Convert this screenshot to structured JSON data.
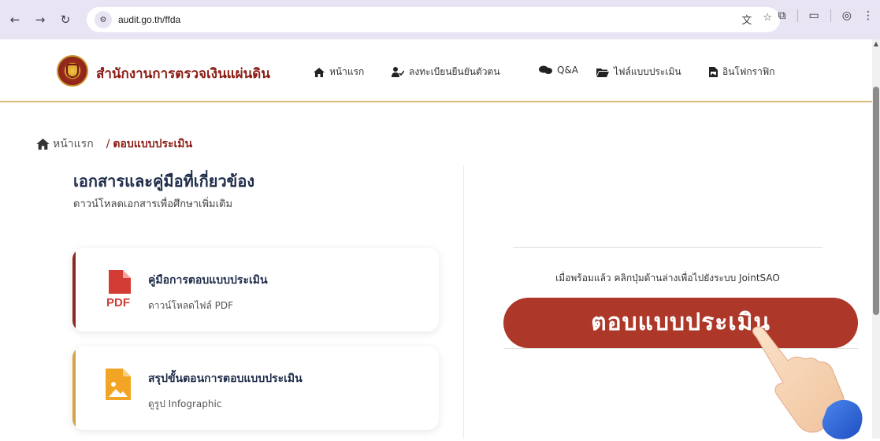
{
  "browser": {
    "back_icon": "arrow-left-icon",
    "forward_icon": "arrow-right-icon",
    "reload_icon": "reload-icon",
    "url": "audit.go.th/ffda"
  },
  "site": {
    "brand": "สำนักงานการตรวจเงินแผ่นดิน",
    "menu": [
      {
        "label": "หน้าแรก",
        "icon": "home-icon"
      },
      {
        "label": "ลงทะเบียนยืนยันตัวตน",
        "icon": "user-check-icon"
      },
      {
        "label": "Q&A",
        "icon": "chat-icon"
      },
      {
        "label": "ไฟล์แบบประเมิน",
        "icon": "folder-icon"
      },
      {
        "label": "อินโฟกราฟิก",
        "icon": "file-image-icon"
      }
    ]
  },
  "breadcrumb": {
    "home": "หน้าแรก",
    "separator": "/",
    "current": "ตอบแบบประเมิน"
  },
  "documents": {
    "title": "เอกสารและคู่มือที่เกี่ยวข้อง",
    "subtitle": "ดาวน์โหลดเอกสารเพื่อศึกษาเพิ่มเติม",
    "cards": [
      {
        "title": "คู่มือการตอบแบบประเมิน",
        "subtitle": "ดาวน์โหลดไฟล์ PDF",
        "icon": "pdf-file-icon",
        "icon_label": "PDF",
        "accent": "#8a2a20"
      },
      {
        "title": "สรุปขั้นตอนการตอบแบบประเมิน",
        "subtitle": "ดูรูป Infographic",
        "icon": "image-file-icon",
        "accent": "#d4a24a"
      }
    ]
  },
  "action": {
    "hint": "เมื่อพร้อมแล้ว คลิกปุ่มด้านล่างเพื่อไปยังระบบ JointSAO",
    "button": "ตอบแบบประเมิน",
    "button_color": "#ad3729"
  },
  "colors": {
    "brand": "#8a1c14",
    "gold": "#d8b979",
    "heading": "#1f2d4a"
  }
}
